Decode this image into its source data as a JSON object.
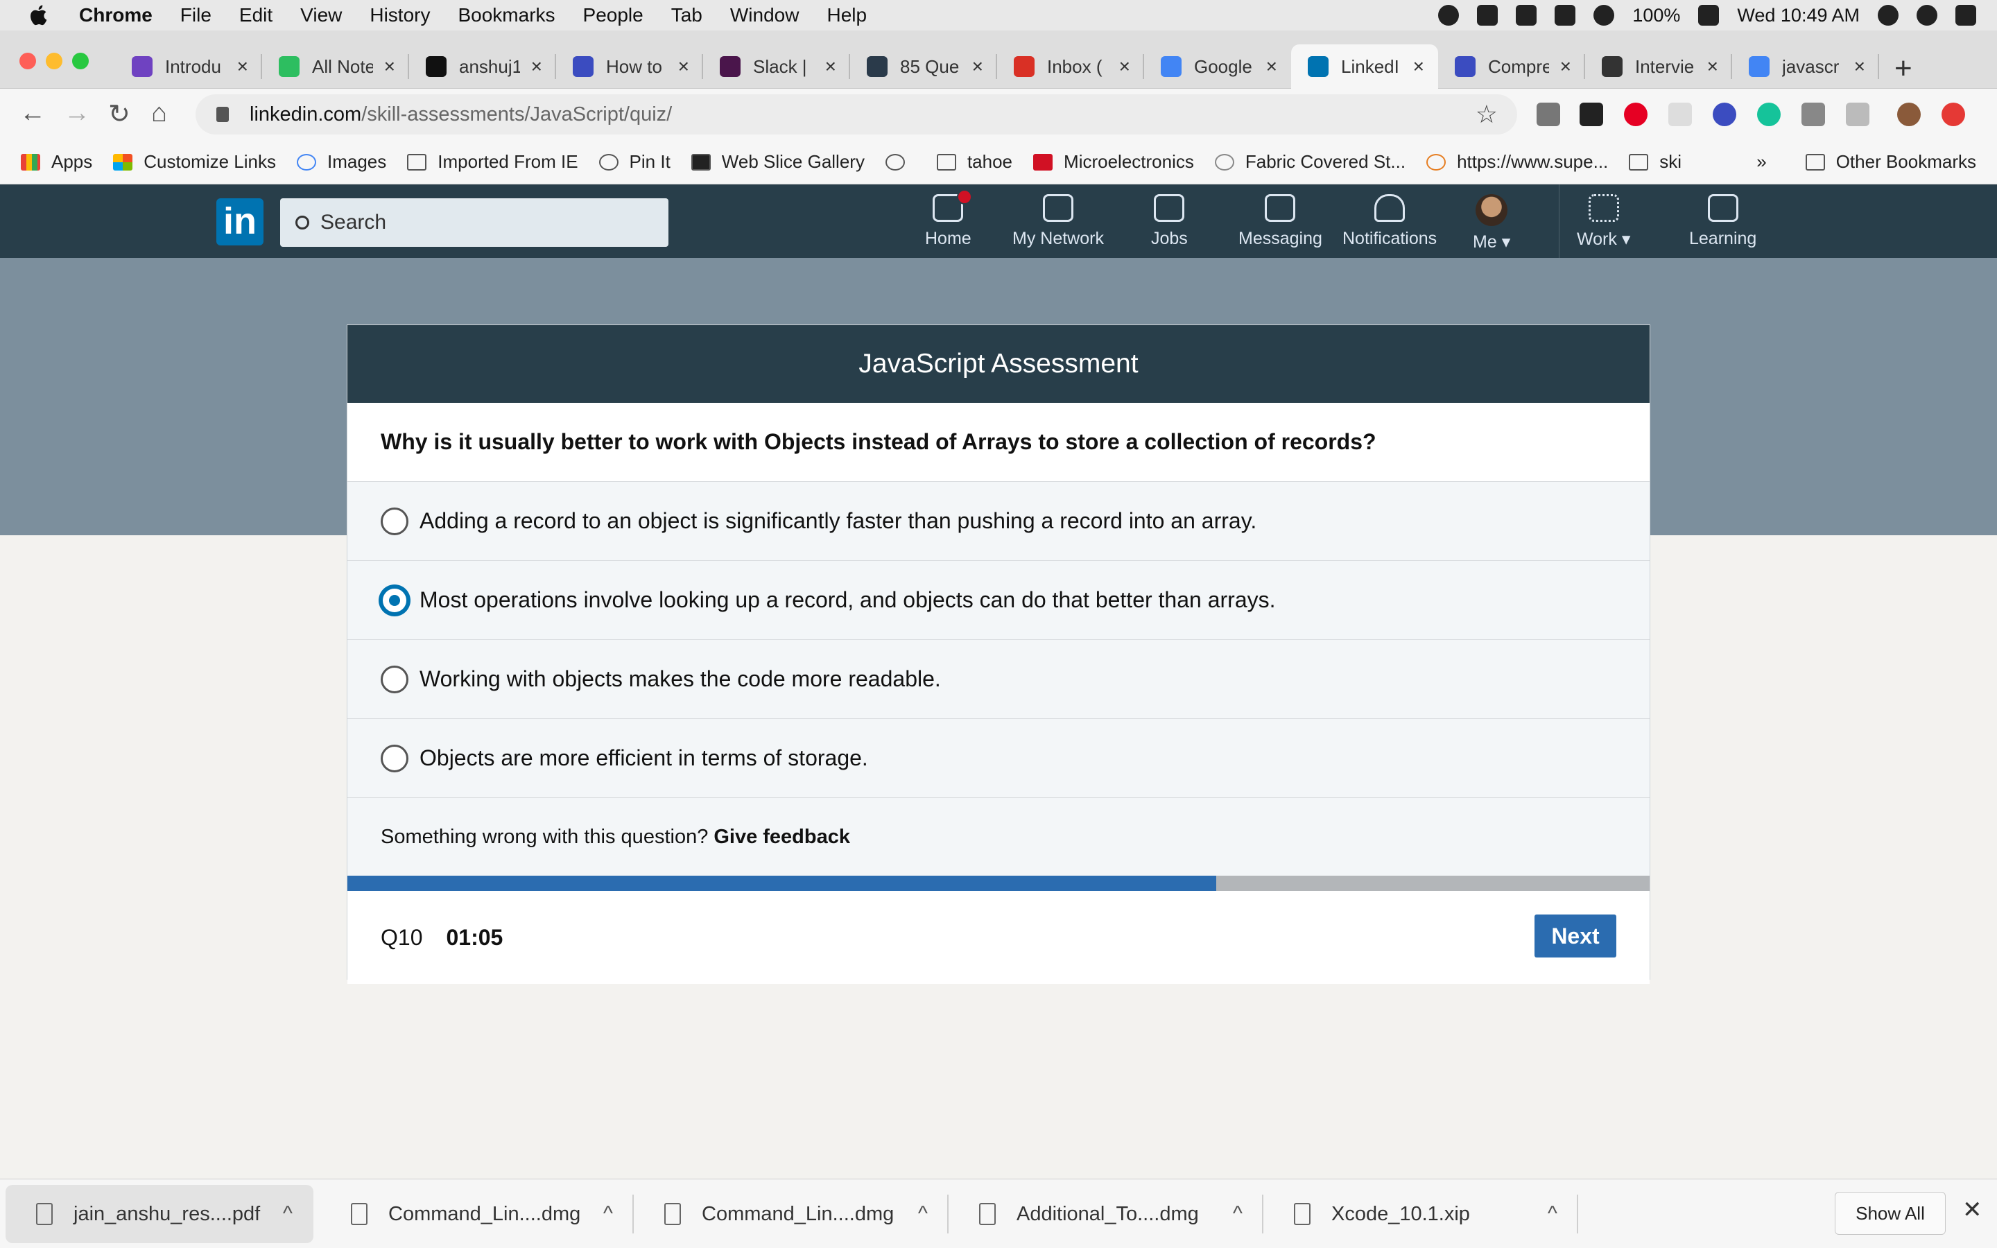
{
  "menubar": {
    "app": "Chrome",
    "items": [
      "File",
      "Edit",
      "View",
      "History",
      "Bookmarks",
      "People",
      "Tab",
      "Window",
      "Help"
    ],
    "battery": "100%",
    "clock": "Wed 10:49 AM"
  },
  "tabs": [
    {
      "label": "Introdu",
      "color": "#6f42c1"
    },
    {
      "label": "All Note",
      "color": "#2dbe60"
    },
    {
      "label": "anshuj1",
      "color": "#111111"
    },
    {
      "label": "How to",
      "color": "#3b4cc0"
    },
    {
      "label": "Slack |",
      "color": "#4a154b"
    },
    {
      "label": "85 Que",
      "color": "#2a3a4a"
    },
    {
      "label": "Inbox (",
      "color": "#d93025"
    },
    {
      "label": "Google",
      "color": "#4285f4"
    },
    {
      "label": "LinkedI",
      "color": "#0073b1"
    },
    {
      "label": "Compre",
      "color": "#3b4cc0"
    },
    {
      "label": "Intervie",
      "color": "#333333"
    },
    {
      "label": "javascr",
      "color": "#4285f4"
    }
  ],
  "active_tab_index": 8,
  "address": {
    "host": "linkedin.com",
    "path": "/skill-assessments/JavaScript/quiz/"
  },
  "bookmarks": {
    "items": [
      "Apps",
      "Customize Links",
      "Images",
      "Imported From IE",
      "Pin It",
      "Web Slice Gallery",
      "",
      "tahoe",
      "Microelectronics",
      "Fabric Covered St...",
      "https://www.supe...",
      "ski"
    ],
    "overflow": "»",
    "other": "Other Bookmarks"
  },
  "linkedin": {
    "logo": "in",
    "search_placeholder": "Search",
    "nav": [
      "Home",
      "My Network",
      "Jobs",
      "Messaging",
      "Notifications",
      "Me",
      "Work",
      "Learning"
    ]
  },
  "quiz": {
    "title": "JavaScript Assessment",
    "question": "Why is it usually better to work with Objects instead of Arrays to store a collection of records?",
    "options": [
      "Adding a record to an object is significantly faster than pushing a record into an array.",
      "Most operations involve looking up a record, and objects can do that better than arrays.",
      "Working with objects makes the code more readable.",
      "Objects are more efficient in terms of storage."
    ],
    "selected_index": 1,
    "feedback_text": "Something wrong with this question?",
    "feedback_link": "Give feedback",
    "progress_fraction": 0.667,
    "question_number": "Q10",
    "timer": "01:05",
    "next_label": "Next",
    "accent_color": "#2b6cb0"
  },
  "downloads": {
    "items": [
      "jain_anshu_res....pdf",
      "Command_Lin....dmg",
      "Command_Lin....dmg",
      "Additional_To....dmg",
      "Xcode_10.1.xip"
    ],
    "show_all": "Show All"
  }
}
